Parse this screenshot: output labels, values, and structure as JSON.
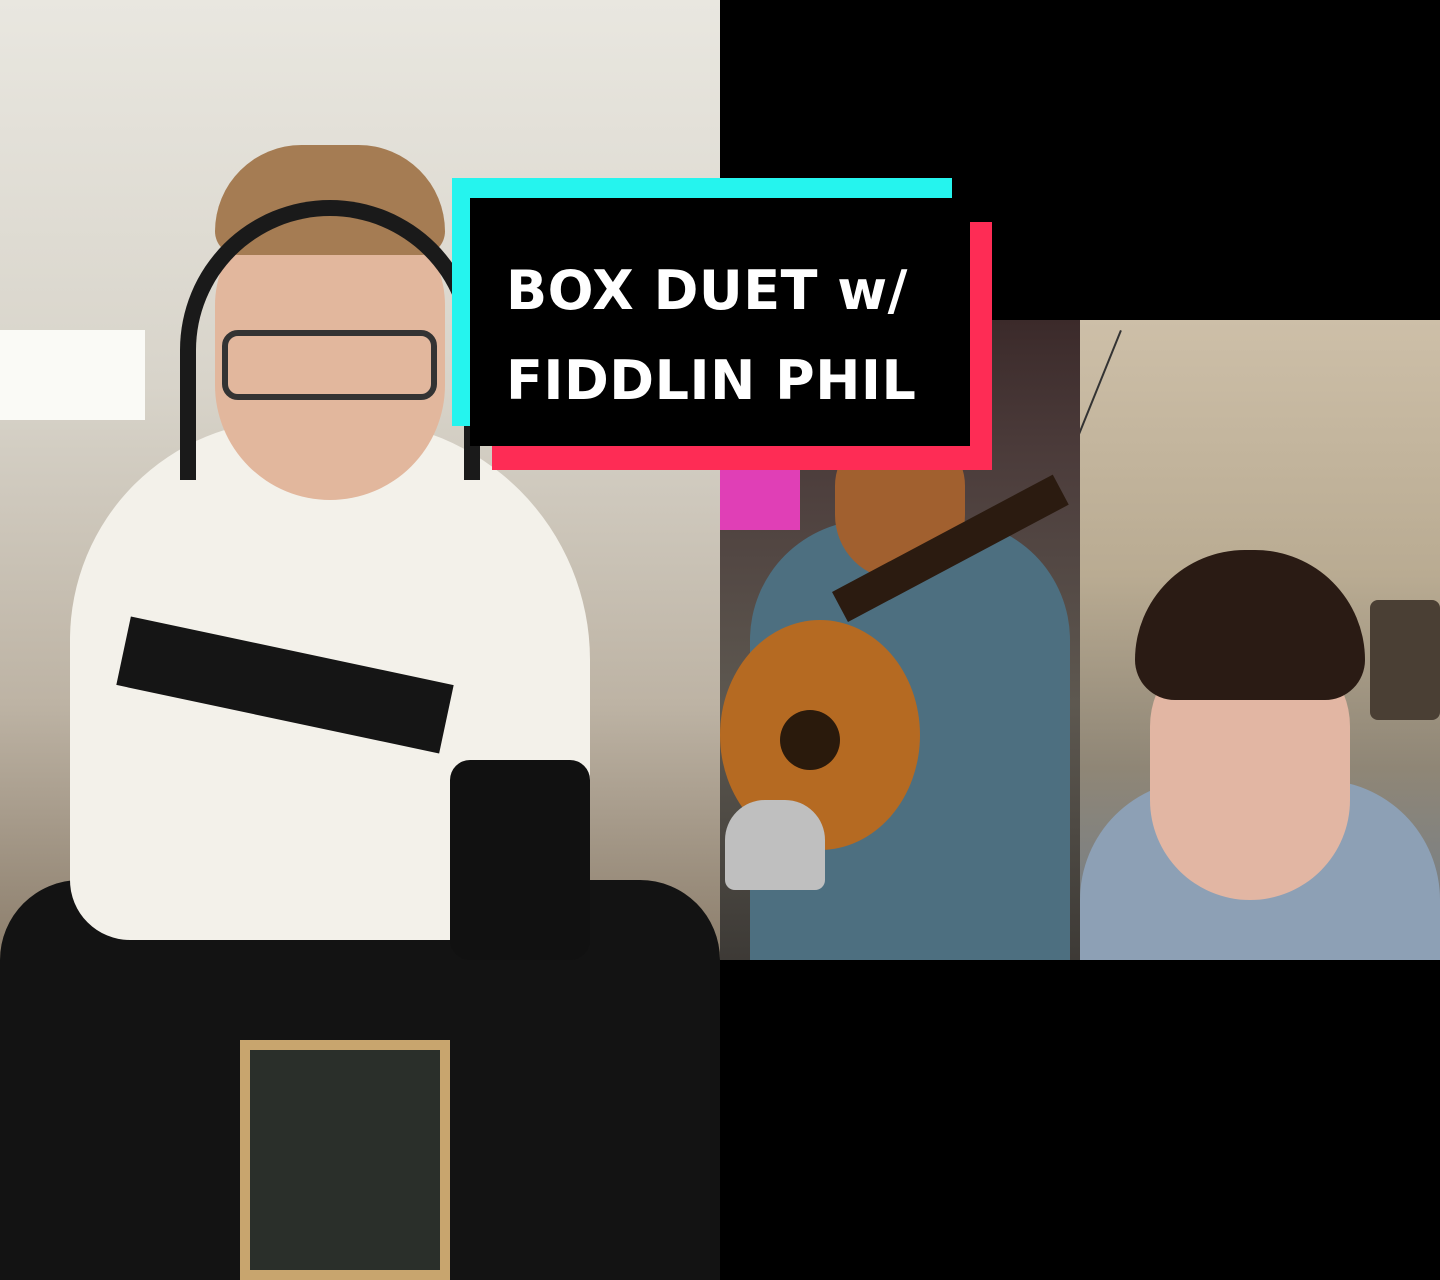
{
  "title_card": {
    "line1": "BOX DUET w/",
    "line2": "FIDDLIN PHIL"
  },
  "colors": {
    "background": "#000000",
    "accent_cyan": "#25f4ee",
    "accent_red": "#fe2c55",
    "title_text": "#ffffff"
  }
}
